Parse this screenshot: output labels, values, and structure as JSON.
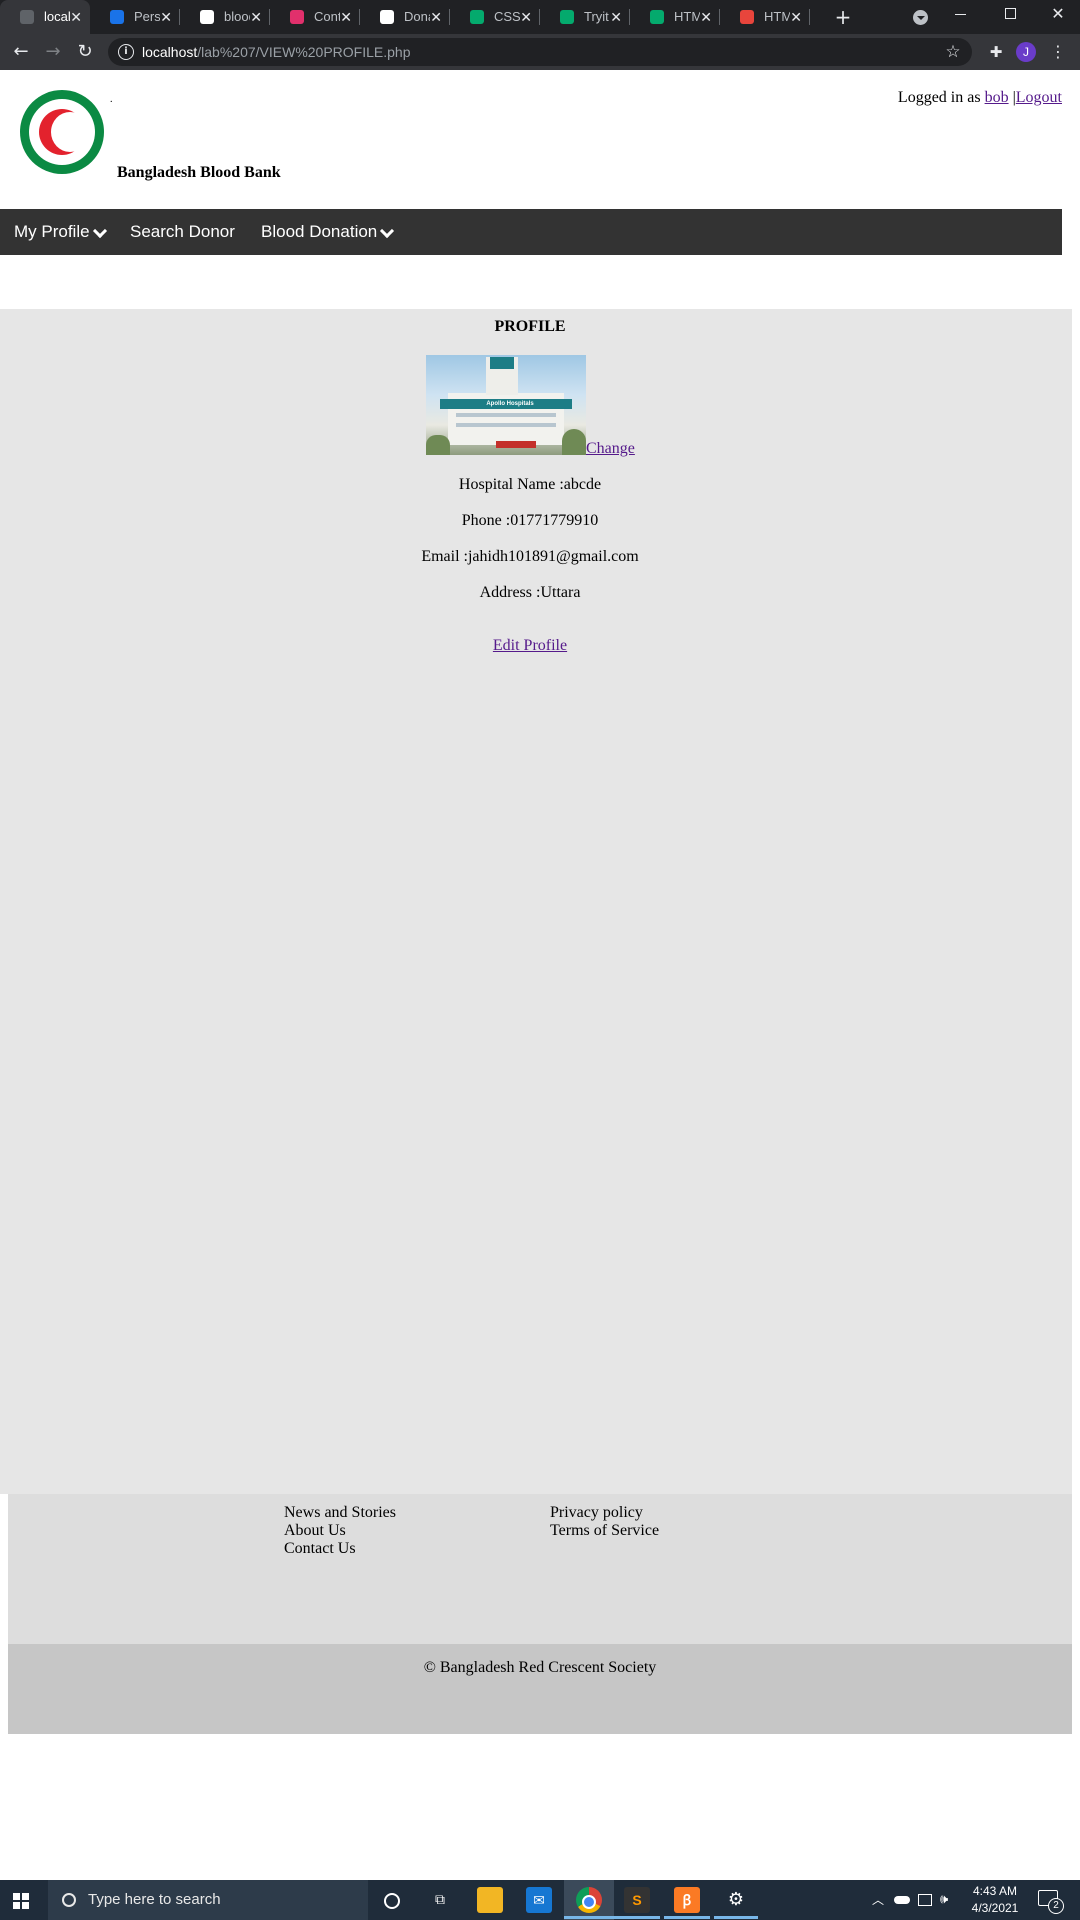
{
  "browser": {
    "tabs": [
      {
        "label": "localh",
        "favicon": "globe-icon",
        "color": "#5f6368",
        "active": true
      },
      {
        "label": "Perso",
        "favicon": "g-icon",
        "color": "#1a73e8"
      },
      {
        "label": "blood",
        "favicon": "google-icon",
        "color": "#ffffff"
      },
      {
        "label": "Cont",
        "favicon": "instagram-icon",
        "color": "#e1306c"
      },
      {
        "label": "Dona",
        "favicon": "red-cross-icon",
        "color": "#ffffff"
      },
      {
        "label": "CSS S",
        "favicon": "w3schools-icon",
        "color": "#04aa6d"
      },
      {
        "label": "Tryit",
        "favicon": "w3schools-icon",
        "color": "#04aa6d"
      },
      {
        "label": "HTM",
        "favicon": "w3schools-icon",
        "color": "#04aa6d"
      },
      {
        "label": "HTM",
        "favicon": "page-icon",
        "color": "#e8453c"
      }
    ],
    "url_host": "localhost",
    "url_path": "/lab%207/VIEW%20PROFILE.php",
    "profile_initial": "J"
  },
  "header": {
    "site_title": "Bangladesh Blood Bank",
    "logged_in_prefix": "Logged in as",
    "username": "bob",
    "separator": "|",
    "logout": "Logout",
    "dot": "."
  },
  "nav": {
    "items": [
      "My Profile",
      "Search Donor",
      "Blood Donation"
    ]
  },
  "profile": {
    "title": "PROFILE",
    "change": "Change",
    "hospital_name": "Hospital Name :abcde",
    "phone": "Phone :01771779910",
    "email": "Email :jahidh101891@gmail.com",
    "address": "Address :Uttara",
    "edit": "Edit Profile",
    "photo_sign": "Apollo Hospitals"
  },
  "footer": {
    "col1": [
      "News and Stories",
      "About Us",
      "Contact Us"
    ],
    "col2": [
      "Privacy policy",
      "Terms of Service"
    ],
    "copyright": "© Bangladesh Red Crescent Society"
  },
  "taskbar": {
    "search_placeholder": "Type here to search",
    "time": "4:43 AM",
    "date": "4/3/2021",
    "notifications": "2"
  }
}
